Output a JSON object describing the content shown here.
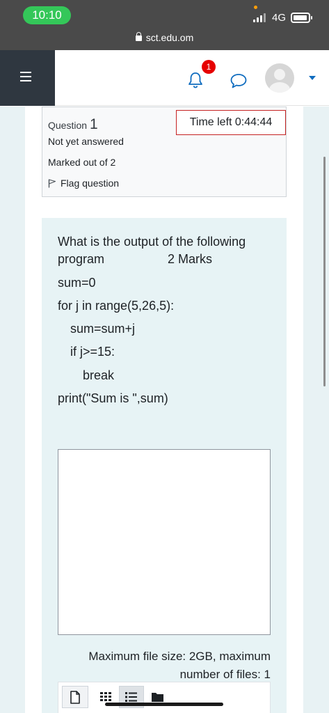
{
  "status_bar": {
    "time": "10:10",
    "network": "4G"
  },
  "browser": {
    "url": "sct.edu.om"
  },
  "header": {
    "notification_count": "1"
  },
  "question_info": {
    "label": "Question",
    "number": "1",
    "state": "Not yet answered",
    "marks": "Marked out of 2",
    "flag_label": "Flag question"
  },
  "timer": {
    "text": "Time left 0:44:44"
  },
  "question": {
    "line1": "What is the output of the following",
    "line2": "program",
    "marks_label": "2 Marks",
    "code": [
      "sum=0",
      "for j in range(5,26,5):",
      "sum=sum+j",
      "if j>=15:",
      "break",
      "print(\"Sum is \",sum)"
    ]
  },
  "answer": {
    "value": ""
  },
  "file_limits": {
    "line1": "Maximum file size: 2GB, maximum",
    "line2": "number of files: 1"
  },
  "icons": [
    "lock-icon",
    "menu-icon",
    "bell-icon",
    "chat-icon",
    "avatar-icon",
    "caret-down-icon",
    "flag-icon",
    "file-icon",
    "grid-view-icon",
    "list-view-icon",
    "folder-icon"
  ],
  "colors": {
    "timer_border": "#c52222",
    "badge": "#e60000",
    "accent": "#0f6cbf",
    "status_pill": "#34c759"
  }
}
